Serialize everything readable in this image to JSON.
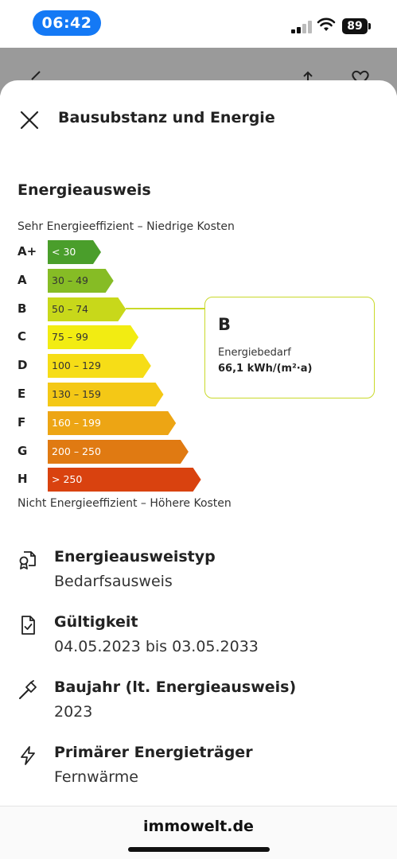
{
  "status_bar": {
    "time": "06:42",
    "battery": "89"
  },
  "sheet": {
    "title": "Bausubstanz und Energie"
  },
  "energy": {
    "section_title": "Energieausweis",
    "top_caption": "Sehr Energieeffizient – Niedrige Kosten",
    "bottom_caption": "Nicht Energieeffizient – Höhere Kosten",
    "classes": [
      {
        "letter": "A+",
        "range": "< 30",
        "color": "#4a9e2b",
        "text_color": "#ffffff"
      },
      {
        "letter": "A",
        "range": "30 – 49",
        "color": "#86bc25",
        "text_color": "#333333"
      },
      {
        "letter": "B",
        "range": "50 – 74",
        "color": "#c8d81a",
        "text_color": "#333333"
      },
      {
        "letter": "C",
        "range": "75 – 99",
        "color": "#f2ec12",
        "text_color": "#333333"
      },
      {
        "letter": "D",
        "range": "100 – 129",
        "color": "#f6dd17",
        "text_color": "#333333"
      },
      {
        "letter": "E",
        "range": "130 – 159",
        "color": "#f4c816",
        "text_color": "#333333"
      },
      {
        "letter": "F",
        "range": "160 – 199",
        "color": "#eda514",
        "text_color": "#ffffff"
      },
      {
        "letter": "G",
        "range": "200 – 250",
        "color": "#e07a12",
        "text_color": "#ffffff"
      },
      {
        "letter": "H",
        "range": "> 250",
        "color": "#d9420f",
        "text_color": "#ffffff"
      }
    ],
    "selected_class": "B",
    "card": {
      "letter": "B",
      "label": "Energiebedarf",
      "value": "66,1 kWh/(m²·a)"
    }
  },
  "details": [
    {
      "icon": "certificate-icon",
      "label": "Energieausweistyp",
      "value": "Bedarfsausweis"
    },
    {
      "icon": "document-check-icon",
      "label": "Gültigkeit",
      "value": "04.05.2023 bis 03.05.2033"
    },
    {
      "icon": "hammer-icon",
      "label": "Baujahr (lt. Energieausweis)",
      "value": "2023"
    },
    {
      "icon": "lightning-icon",
      "label": "Primärer Energieträger",
      "value": "Fernwärme"
    }
  ],
  "browser": {
    "domain": "immowelt.de"
  }
}
